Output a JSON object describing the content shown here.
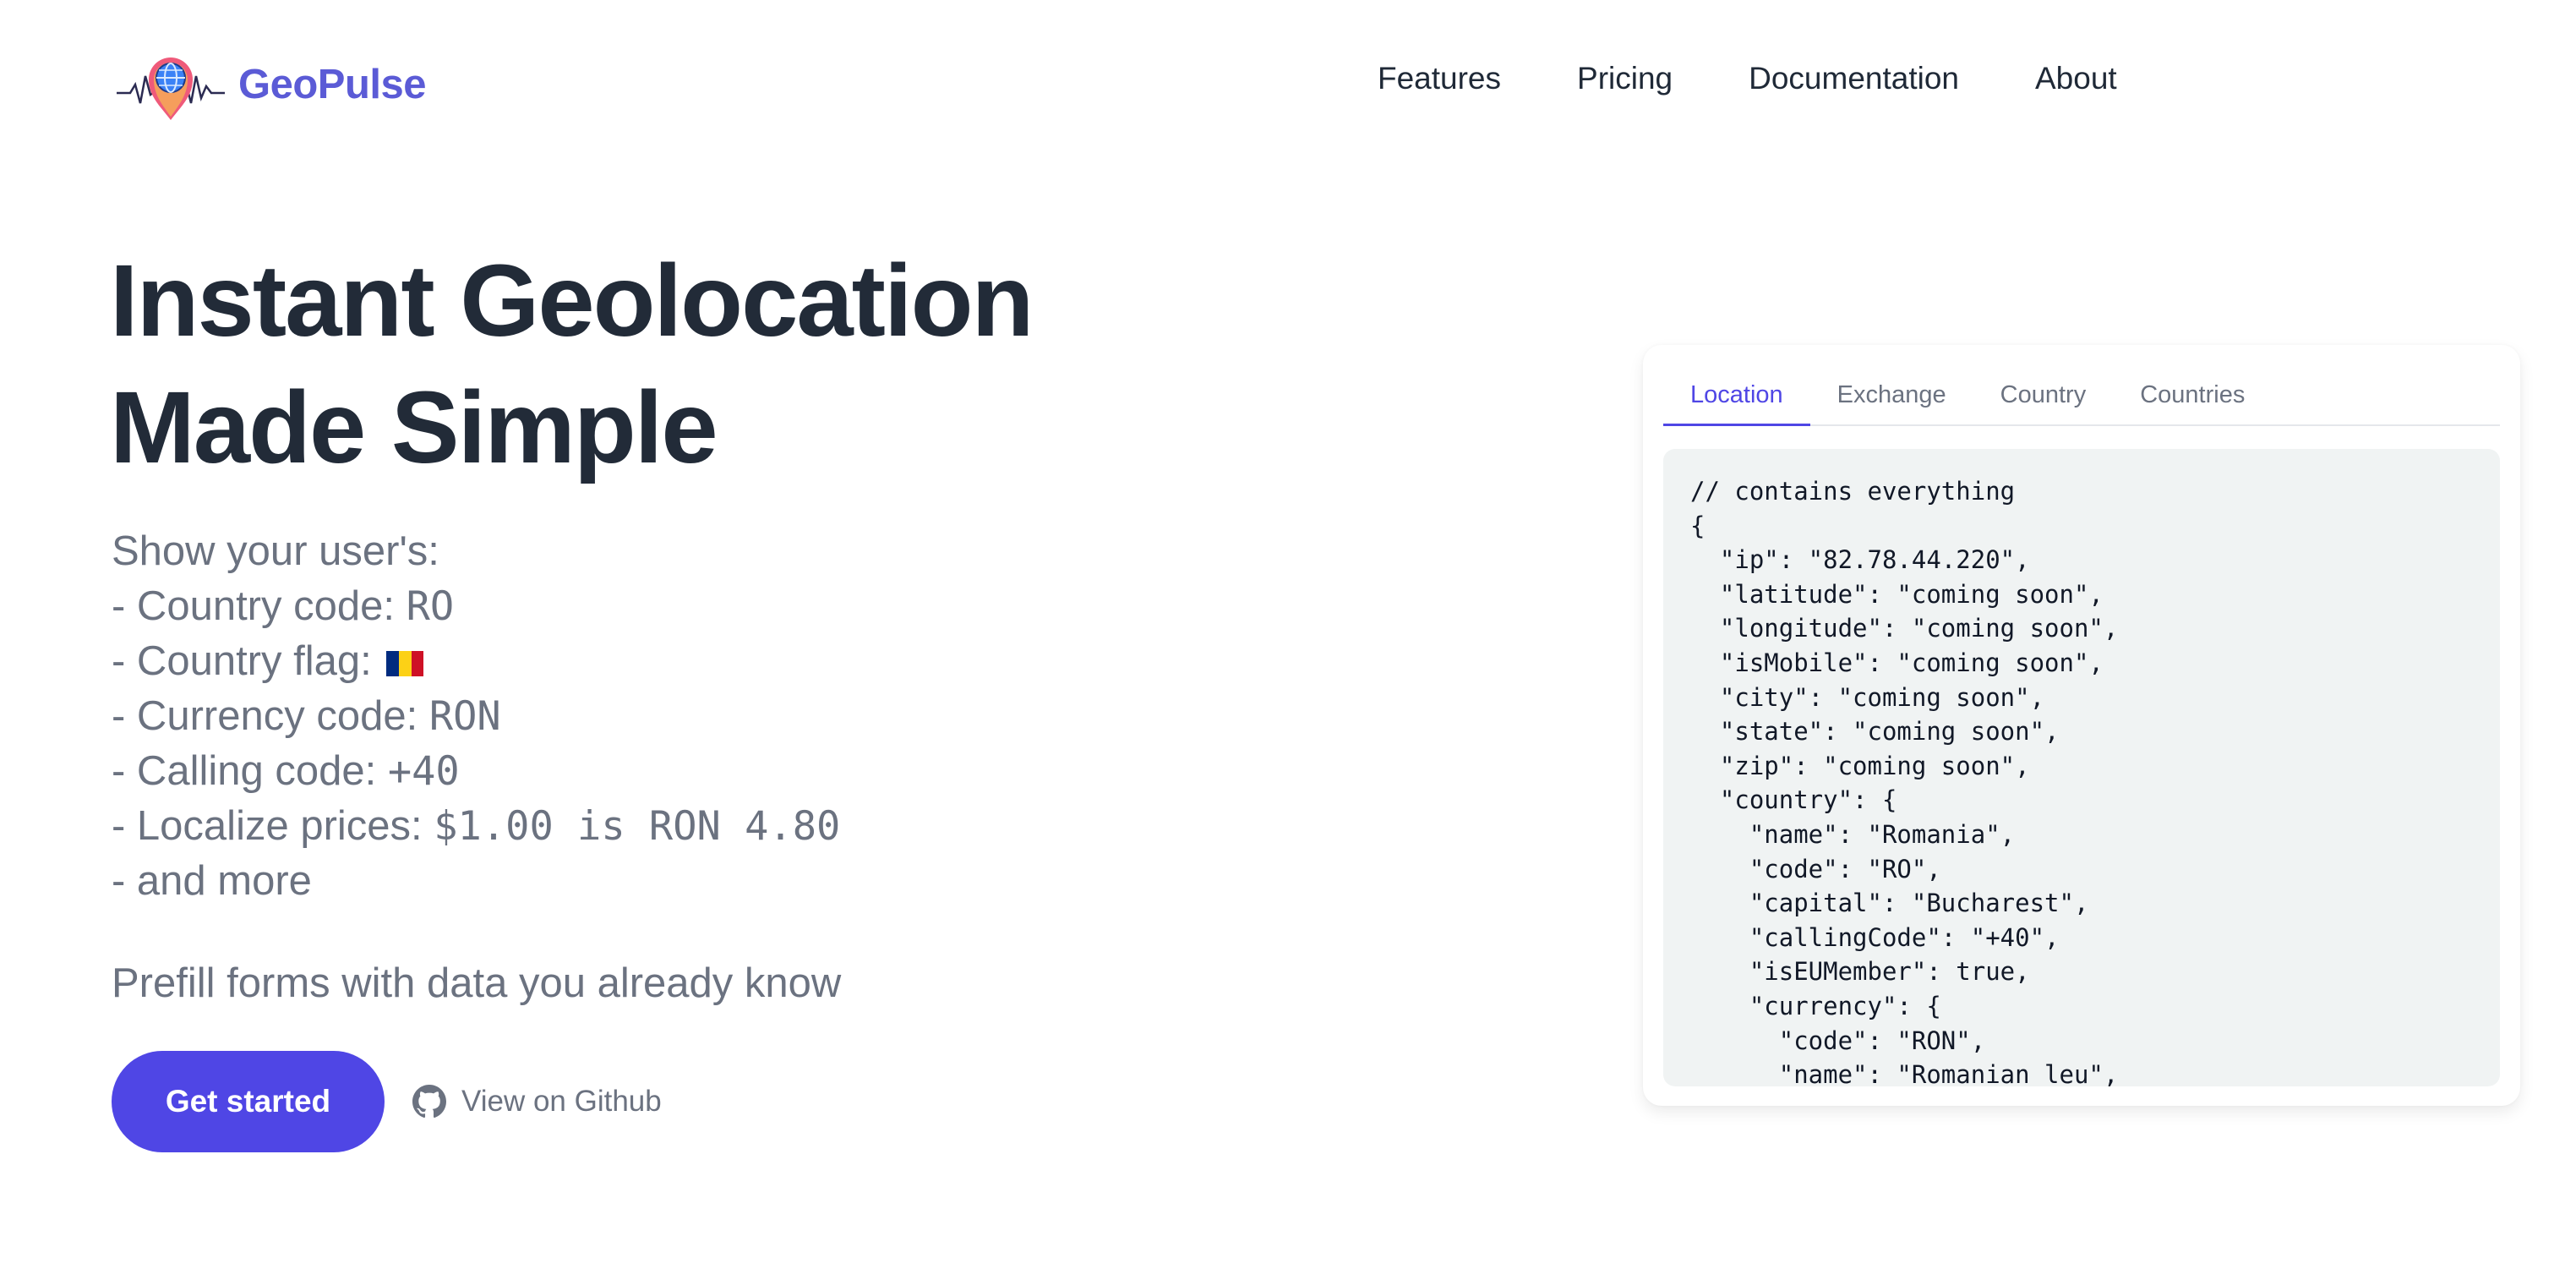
{
  "brand": {
    "name": "GeoPulse",
    "logo_icon": "globe-pin-pulse-icon"
  },
  "nav": {
    "items": [
      "Features",
      "Pricing",
      "Documentation",
      "About"
    ]
  },
  "hero": {
    "title_line1": "Instant Geolocation",
    "title_line2": "Made Simple",
    "intro": "Show your user's:",
    "country_code_label": "- Country code: ",
    "country_code_value": "RO",
    "flag_label": "- Country flag: ",
    "flag_colors": [
      "#002B7F",
      "#FCD116",
      "#CE1126"
    ],
    "currency_label": "- Currency code: ",
    "currency_value": "RON",
    "calling_label": "- Calling code: ",
    "calling_value": "+40",
    "prices_label": "- Localize prices: ",
    "prices_value": "$1.00 is RON 4.80",
    "more": "- and more",
    "prefill": "Prefill forms with data you already know",
    "cta_label": "Get started",
    "github_label": "View on Github",
    "accent_color": "#4f46e5"
  },
  "card": {
    "tabs": [
      "Location",
      "Exchange",
      "Country",
      "Countries"
    ],
    "active_tab": "Location",
    "code_lines": [
      "// contains everything",
      "{",
      "  \"ip\": \"82.78.44.220\",",
      "  \"latitude\": \"coming soon\",",
      "  \"longitude\": \"coming soon\",",
      "  \"isMobile\": \"coming soon\",",
      "  \"city\": \"coming soon\",",
      "  \"state\": \"coming soon\",",
      "  \"zip\": \"coming soon\",",
      "  \"country\": {",
      "    \"name\": \"Romania\",",
      "    \"code\": \"RO\",",
      "    \"capital\": \"Bucharest\",",
      "    \"callingCode\": \"+40\",",
      "    \"isEUMember\": true,",
      "    \"currency\": {",
      "      \"code\": \"RON\",",
      "      \"name\": \"Romanian leu\","
    ]
  }
}
